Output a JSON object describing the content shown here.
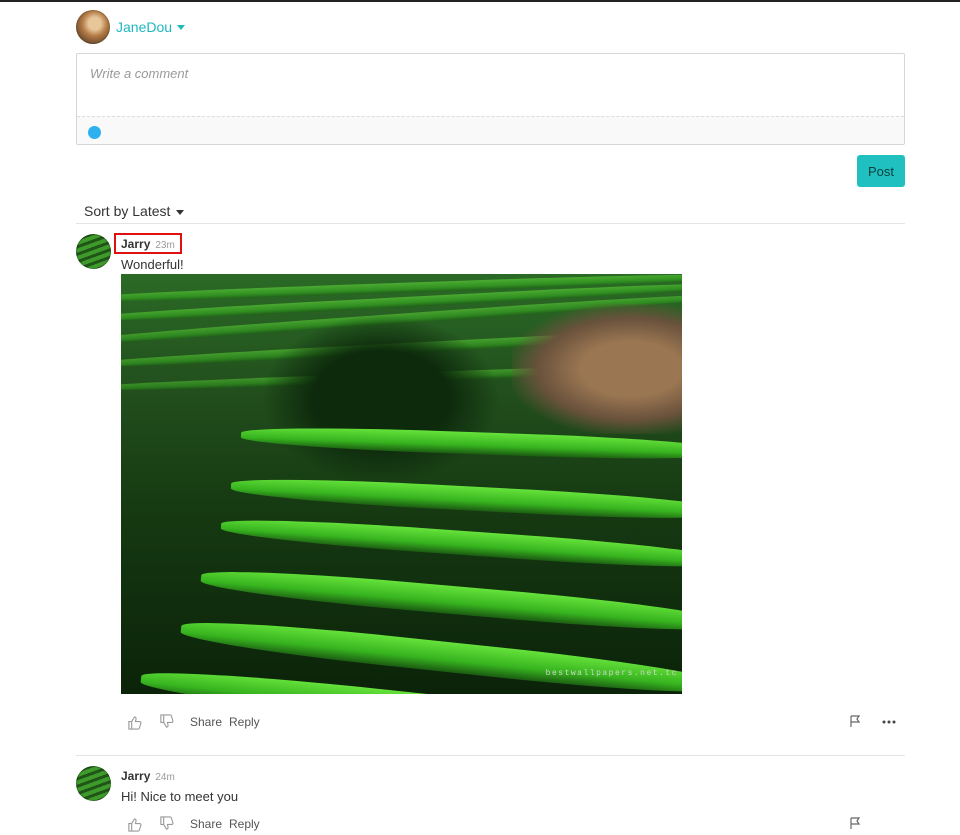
{
  "user": {
    "name": "JaneDou"
  },
  "composer": {
    "placeholder": "Write a comment"
  },
  "post_button": "Post",
  "sort": {
    "label": "Sort by Latest"
  },
  "comments": [
    {
      "author": "Jarry",
      "time": "23m",
      "text": "Wonderful!",
      "image_watermark": "bestwallpapers.net.tc",
      "actions": {
        "share": "Share",
        "reply": "Reply"
      }
    },
    {
      "author": "Jarry",
      "time": "24m",
      "text": "Hi! Nice to meet you",
      "actions": {
        "share": "Share",
        "reply": "Reply"
      }
    }
  ],
  "colors": {
    "accent": "#1fb8c0",
    "post_button": "#20c0c0",
    "highlight": "#e01010",
    "toolbar_dot": "#2fb1ef"
  },
  "icons": [
    "caret-down-icon",
    "emoji-dot-icon",
    "like-icon",
    "dislike-icon",
    "flag-icon",
    "more-icon"
  ]
}
